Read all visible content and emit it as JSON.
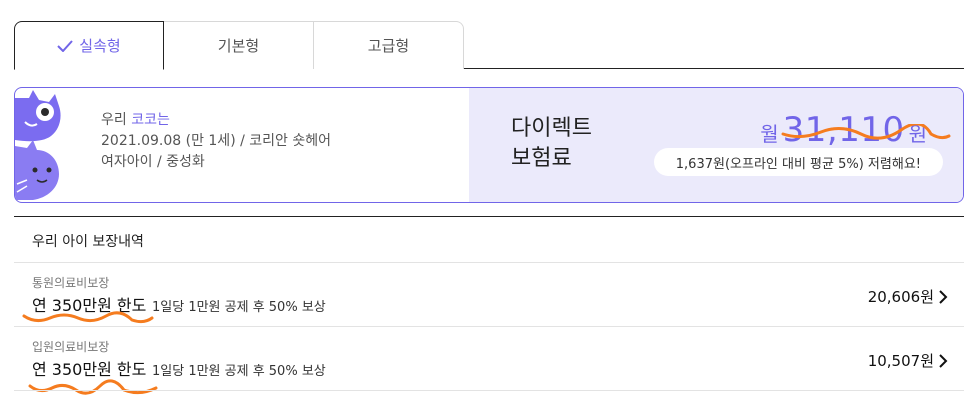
{
  "tabs": [
    {
      "label": "실속형",
      "active": true
    },
    {
      "label": "기본형",
      "active": false
    },
    {
      "label": "고급형",
      "active": false
    }
  ],
  "pet": {
    "prefix": "우리",
    "name": "코코는",
    "birth_line": "2021.09.08 (만 1세) / 코리안 숏헤어",
    "detail_line": "여자아이 / 중성화"
  },
  "premium": {
    "title_line1": "다이렉트",
    "title_line2": "보험료",
    "unit_prefix": "월",
    "amount": "31,110",
    "unit_suffix": "원",
    "savings": "1,637원(오프라인 대비 평균 5%) 저렴해요!"
  },
  "coverage": {
    "title": "우리 아이 보장내역",
    "items": [
      {
        "category": "통원의료비보장",
        "limit": "연 350만원 한도",
        "description": "1일당 1만원 공제 후 50% 보상",
        "amount": "20,606원"
      },
      {
        "category": "입원의료비보장",
        "limit": "연 350만원 한도",
        "description": "1일당 1만원 공제 후 50% 보상",
        "amount": "10,507원"
      }
    ]
  },
  "colors": {
    "accent": "#7165e8",
    "panel_bg": "#ebeafb",
    "scribble": "#f57c1f"
  },
  "icons": {
    "check": "check-icon",
    "chevron": "chevron-right-icon",
    "pets": "cat-illustration"
  }
}
